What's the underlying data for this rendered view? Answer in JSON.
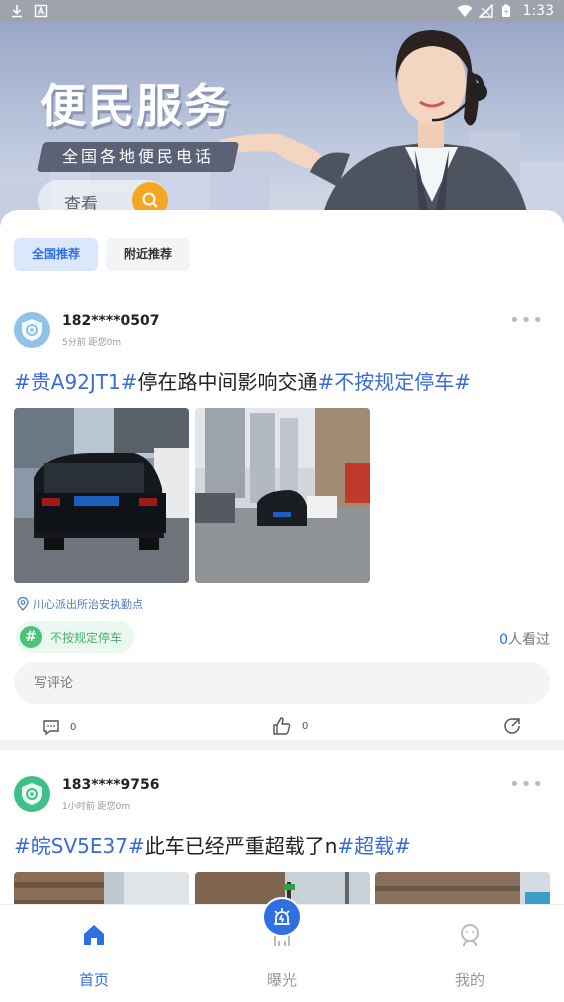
{
  "status_bar": {
    "time": "1:33"
  },
  "banner": {
    "title": "便民服务",
    "subtitle": "全国各地便民电话",
    "search_label": "查看",
    "accent": "#f5a623"
  },
  "tabs": [
    {
      "label": "全国推荐",
      "active": true
    },
    {
      "label": "附近推荐",
      "active": false
    }
  ],
  "posts": [
    {
      "user": "182****0507",
      "meta": "5分前 距您0m",
      "text_tag1": "#贵A92JT1#",
      "text_body": "停在路中间影响交通",
      "text_tag2": "#不按规定停车#",
      "location": "川心派出所治安执勤点",
      "topic": "不按规定停车",
      "views_num": "0",
      "views_suffix": "人看过",
      "comment_placeholder": "写评论",
      "comment_count": "0",
      "like_count": "0",
      "avatar_color": "#8fc3e8"
    },
    {
      "user": "183****9756",
      "meta": "1小时前 距您0m",
      "text_tag1": "#皖SV5E37#",
      "text_body": "此车已经严重超载了n",
      "text_tag2": "#超载#",
      "avatar_color": "#3fbf8a"
    }
  ],
  "bottom_nav": [
    {
      "label": "首页",
      "icon": "home-icon",
      "active": true
    },
    {
      "label": "曝光",
      "icon": "alarm-icon",
      "active": false
    },
    {
      "label": "我的",
      "icon": "profile-icon",
      "active": false
    }
  ],
  "colors": {
    "primary": "#2f6fe4",
    "tag": "#3a6ad8",
    "topic_green": "#4bc37a"
  }
}
